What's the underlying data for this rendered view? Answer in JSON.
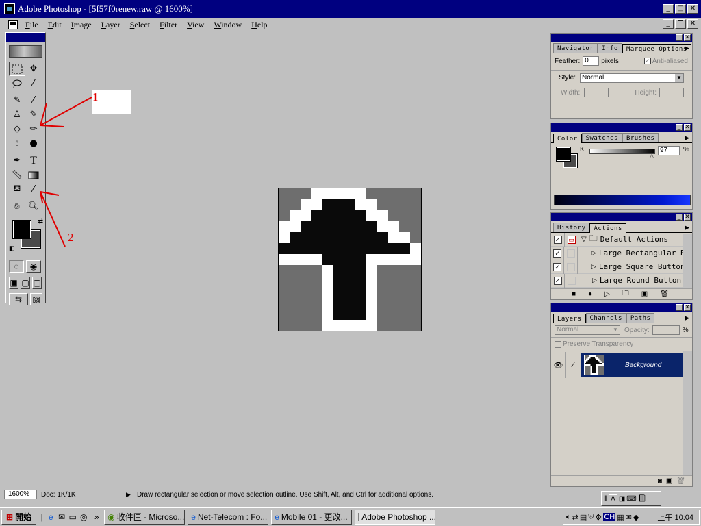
{
  "window": {
    "title": "Adobe Photoshop - [5f57f0renew.raw @ 1600%]"
  },
  "menu": [
    "File",
    "Edit",
    "Image",
    "Layer",
    "Select",
    "Filter",
    "View",
    "Window",
    "Help"
  ],
  "annotations": {
    "label1": "1",
    "label2": "2",
    "color": "#e00000"
  },
  "navigator_palette": {
    "tabs": [
      "Navigator",
      "Info",
      "Marquee Options"
    ],
    "feather_label": "Feather:",
    "feather_value": "0",
    "feather_unit": "pixels",
    "anti_aliased": "Anti-aliased",
    "style_label": "Style:",
    "style_value": "Normal",
    "width_label": "Width:",
    "height_label": "Height:"
  },
  "color_palette": {
    "tabs": [
      "Color",
      "Swatches",
      "Brushes"
    ],
    "channel": "K",
    "value": "97",
    "unit": "%",
    "foreground": "#000000",
    "background": "#4b4b4b"
  },
  "actions_palette": {
    "tabs": [
      "History",
      "Actions"
    ],
    "set_name": "Default Actions",
    "items": [
      "Large Rectangular B",
      "Large Square Button",
      "Large Round Button"
    ]
  },
  "layers_palette": {
    "tabs": [
      "Layers",
      "Channels",
      "Paths"
    ],
    "mode": "Normal",
    "opacity_label": "Opacity:",
    "opacity_unit": "%",
    "preserve_transparency": "Preserve Transparency",
    "layer_name": "Background"
  },
  "status": {
    "zoom": "1600%",
    "doc": "Doc: 1K/1K",
    "message": "Draw rectangular selection or move selection outline.  Use Shift, Alt, and Ctrl for additional options."
  },
  "taskbar": {
    "start_label": "開始",
    "tasks": [
      "收件匣 - Microso...",
      "Net-Telecom : Fo...",
      "Mobile 01 - 更改...",
      "Adobe Photoshop ..."
    ],
    "ime": "CH",
    "clock": "上午 10:04"
  },
  "icons": [
    "photoshop-icon",
    "marquee-icon",
    "move-icon",
    "lasso-icon",
    "magic-wand-icon",
    "airbrush-icon",
    "paintbrush-icon",
    "rubber-stamp-icon",
    "history-brush-icon",
    "eraser-icon",
    "pencil-icon",
    "blur-icon",
    "burn-icon",
    "pen-icon",
    "type-icon",
    "measure-icon",
    "gradient-icon",
    "paint-bucket-icon",
    "eyedropper-icon",
    "hand-icon",
    "zoom-icon"
  ]
}
